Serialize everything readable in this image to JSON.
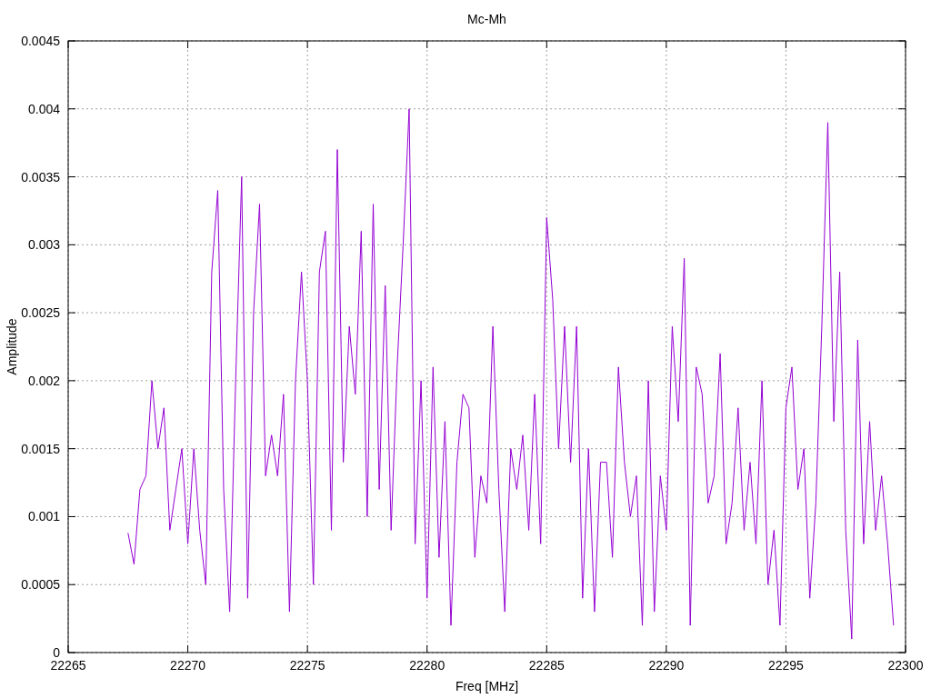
{
  "chart": {
    "chart_data": {
      "type": "line",
      "grid": true,
      "title": "Mc-Mh",
      "xlabel": "Freq [MHz]",
      "ylabel": "Amplitude",
      "xlim": [
        22265,
        22300
      ],
      "ylim": [
        0,
        0.0045
      ],
      "xticks": [
        22265,
        22270,
        22275,
        22280,
        22285,
        22290,
        22295,
        22300
      ],
      "yticks": [
        0,
        0.0005,
        0.001,
        0.0015,
        0.002,
        0.0025,
        0.003,
        0.0035,
        0.004,
        0.0045
      ],
      "x": [
        22267.5,
        22267.75,
        22268,
        22268.25,
        22268.5,
        22268.75,
        22269,
        22269.25,
        22269.5,
        22269.75,
        22270,
        22270.25,
        22270.5,
        22270.75,
        22271,
        22271.25,
        22271.5,
        22271.75,
        22272,
        22272.25,
        22272.5,
        22272.75,
        22273,
        22273.25,
        22273.5,
        22273.75,
        22274,
        22274.25,
        22274.5,
        22274.75,
        22275,
        22275.25,
        22275.5,
        22275.75,
        22276,
        22276.25,
        22276.5,
        22276.75,
        22277,
        22277.25,
        22277.5,
        22277.75,
        22278,
        22278.25,
        22278.5,
        22278.75,
        22279,
        22279.25,
        22279.5,
        22279.75,
        22280,
        22280.25,
        22280.5,
        22280.75,
        22281,
        22281.25,
        22281.5,
        22281.75,
        22282,
        22282.25,
        22282.5,
        22282.75,
        22283,
        22283.25,
        22283.5,
        22283.75,
        22284,
        22284.25,
        22284.5,
        22284.75,
        22285,
        22285.25,
        22285.5,
        22285.75,
        22286,
        22286.25,
        22286.5,
        22286.75,
        22287,
        22287.25,
        22287.5,
        22287.75,
        22288,
        22288.25,
        22288.5,
        22288.75,
        22289,
        22289.25,
        22289.5,
        22289.75,
        22290,
        22290.25,
        22290.5,
        22290.75,
        22291,
        22291.25,
        22291.5,
        22291.75,
        22292,
        22292.25,
        22292.5,
        22292.75,
        22293,
        22293.25,
        22293.5,
        22293.75,
        22294,
        22294.25,
        22294.5,
        22294.75,
        22295,
        22295.25,
        22295.5,
        22295.75,
        22296,
        22296.25,
        22296.5,
        22296.75,
        22297,
        22297.25,
        22297.5,
        22297.75,
        22298,
        22298.25,
        22298.5,
        22298.75,
        22299,
        22299.25,
        22299.5
      ],
      "series": [
        {
          "color": "#9400d3",
          "values": [
            0.00088,
            0.00065,
            0.0012,
            0.0013,
            0.002,
            0.0015,
            0.0018,
            0.0009,
            0.0012,
            0.0015,
            0.0008,
            0.0015,
            0.0009,
            0.0005,
            0.0028,
            0.0034,
            0.0012,
            0.0003,
            0.002,
            0.0035,
            0.0004,
            0.0025,
            0.0033,
            0.0013,
            0.0016,
            0.0013,
            0.0019,
            0.0003,
            0.002,
            0.0028,
            0.002,
            0.0005,
            0.0028,
            0.0031,
            0.0009,
            0.0037,
            0.0014,
            0.0024,
            0.0019,
            0.0031,
            0.001,
            0.0033,
            0.0012,
            0.0027,
            0.0009,
            0.0021,
            0.003,
            0.004,
            0.0008,
            0.002,
            0.0004,
            0.0021,
            0.0007,
            0.0017,
            0.0002,
            0.0014,
            0.0019,
            0.0018,
            0.0007,
            0.0013,
            0.0011,
            0.0024,
            0.0012,
            0.0003,
            0.0015,
            0.0012,
            0.0016,
            0.0009,
            0.0019,
            0.0008,
            0.0032,
            0.0026,
            0.0015,
            0.0024,
            0.0014,
            0.0024,
            0.0004,
            0.0015,
            0.0003,
            0.0014,
            0.0014,
            0.0007,
            0.0021,
            0.0014,
            0.001,
            0.0013,
            0.0002,
            0.002,
            0.0003,
            0.0013,
            0.0009,
            0.0024,
            0.0017,
            0.0029,
            0.0002,
            0.0021,
            0.0019,
            0.0011,
            0.0013,
            0.0022,
            0.0008,
            0.0011,
            0.0018,
            0.0009,
            0.0014,
            0.0008,
            0.002,
            0.0005,
            0.0009,
            0.0002,
            0.0018,
            0.0021,
            0.0012,
            0.0015,
            0.0004,
            0.0011,
            0.0024,
            0.0039,
            0.0017,
            0.0028,
            0.0009,
            0.0001,
            0.0023,
            0.0008,
            0.0017,
            0.0009,
            0.0013,
            0.0008,
            0.0002
          ]
        }
      ]
    }
  }
}
